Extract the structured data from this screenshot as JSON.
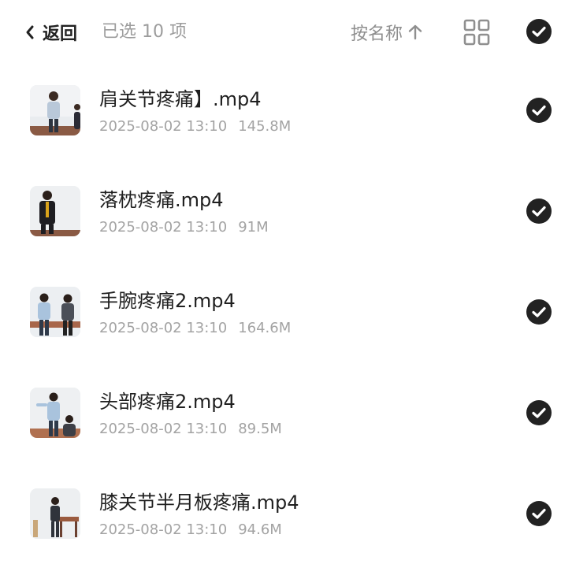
{
  "header": {
    "back_label": "返回",
    "selected_text": "已选 10 项",
    "sort_label": "按名称",
    "icons": {
      "back": "chevron-left-icon",
      "sort": "arrow-up-icon",
      "view": "grid-view-icon",
      "select_all": "check-circle-icon"
    }
  },
  "files": [
    {
      "name": "肩关节疼痛】.mp4",
      "date": "2025-08-02 13:10",
      "size": "145.8M",
      "selected": true
    },
    {
      "name": "落枕疼痛.mp4",
      "date": "2025-08-02 13:10",
      "size": "91M",
      "selected": true
    },
    {
      "name": "手腕疼痛2.mp4",
      "date": "2025-08-02 13:10",
      "size": "164.6M",
      "selected": true
    },
    {
      "name": "头部疼痛2.mp4",
      "date": "2025-08-02 13:10",
      "size": "89.5M",
      "selected": true
    },
    {
      "name": "膝关节半月板疼痛.mp4",
      "date": "2025-08-02 13:10",
      "size": "94.6M",
      "selected": true
    }
  ],
  "colors": {
    "accent": "#1f1f1f",
    "muted_text": "#a3a3a3",
    "check_fill": "#222222"
  }
}
